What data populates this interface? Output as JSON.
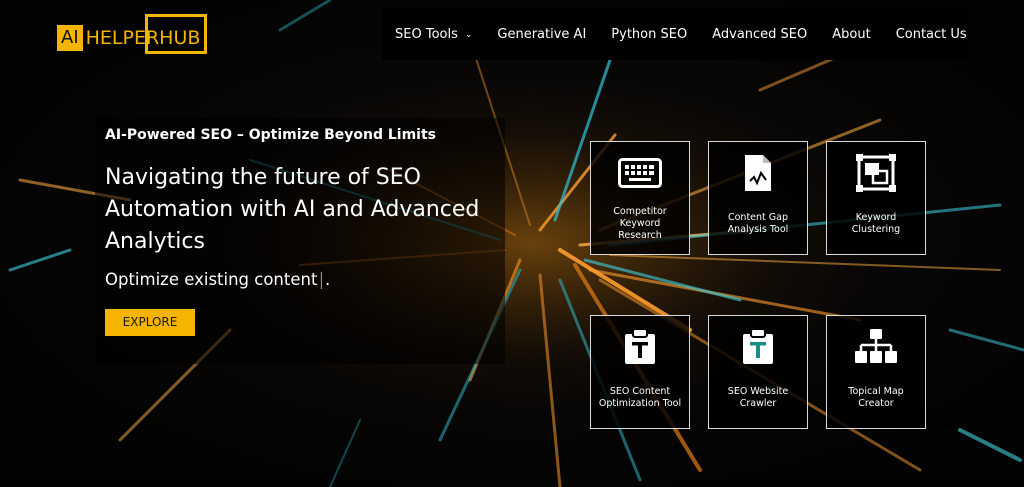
{
  "brand": {
    "logo_ai": "AI",
    "logo_text": "HELPERHUB",
    "accent": "#f5b400"
  },
  "nav": {
    "items": [
      {
        "label": "SEO Tools",
        "has_dropdown": true
      },
      {
        "label": "Generative AI"
      },
      {
        "label": "Python SEO"
      },
      {
        "label": "Advanced SEO"
      },
      {
        "label": "About"
      },
      {
        "label": "Contact Us"
      }
    ]
  },
  "hero": {
    "tagline": "AI-Powered SEO – Optimize Beyond Limits",
    "headline": "Navigating the future of SEO Automation with AI and Advanced Analytics",
    "typed_text": "Optimize existing content",
    "typed_suffix": ".",
    "cta_label": "EXPLORE"
  },
  "tools": [
    {
      "label": "Competitor Keyword Research",
      "icon": "keyboard-icon"
    },
    {
      "label": "Content Gap Analysis Tool",
      "icon": "document-chart-icon"
    },
    {
      "label": "Keyword Clustering",
      "icon": "cluster-icon"
    },
    {
      "label": "SEO Content Optimization Tool",
      "icon": "clipboard-text-icon"
    },
    {
      "label": "SEO Website Crawler",
      "icon": "clipboard-crawler-icon"
    },
    {
      "label": "Topical Map Creator",
      "icon": "sitemap-icon"
    }
  ]
}
